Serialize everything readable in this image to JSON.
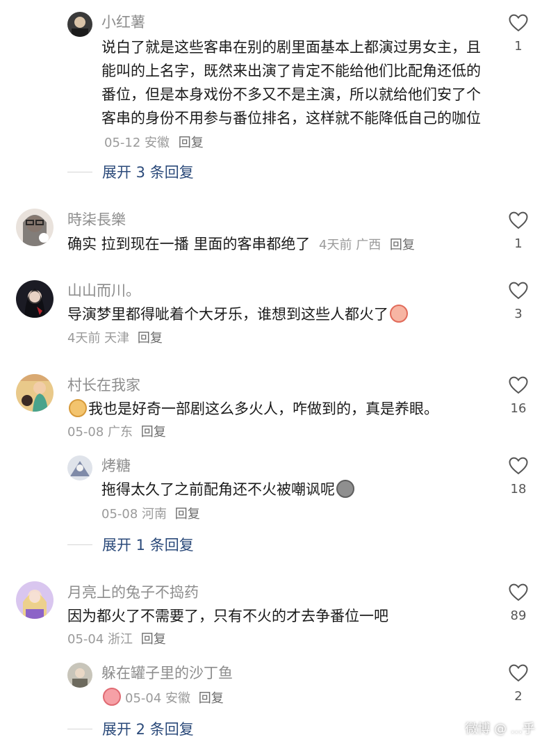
{
  "colors": {
    "name": "#8d8d8d",
    "text": "#1a1a1a",
    "meta": "#9a9a9a",
    "expand": "#2b4a7a",
    "like_icon": "#555555"
  },
  "comments": [
    {
      "name": "小红薯",
      "text": "说白了就是这些客串在别的剧里面基本上都演过男女主，且能叫的上名字，既然来出演了肯定不能给他们比配角还低的番位，但是本身戏份不多又不是主演，所以就给他们安了个客串的身份不用参与番位排名，这样就不能降低自己的咖位",
      "meta": "05-12 安徽",
      "reply": "回复",
      "likes": "1",
      "expand": "展开 3 条回复"
    },
    {
      "name": "時柒長樂",
      "text": "确实 拉到现在一播 里面的客串都绝了",
      "meta": "4天前 广西",
      "reply": "回复",
      "likes": "1"
    },
    {
      "name": "山山而川。",
      "text": "导演梦里都得呲着个大牙乐，谁想到这些人都火了",
      "emoji": "crying-face-emoji",
      "meta": "4天前 天津",
      "reply": "回复",
      "likes": "3"
    },
    {
      "name": "村长在我家",
      "emoji": "dog-face-emoji",
      "text": "我也是好奇一部剧这么多火人，咋做到的，真是养眼。",
      "meta": "05-08 广东",
      "reply": "回复",
      "likes": "16",
      "sub": {
        "name": "烤糖",
        "text": "拖得太久了之前配角还不火被嘲讽呢",
        "emoji": "money-bag-emoji",
        "meta": "05-08 河南",
        "reply": "回复",
        "likes": "18"
      },
      "expand": "展开 1 条回复"
    },
    {
      "name": "月亮上的兔子不捣药",
      "text": "因为都火了不需要了，只有不火的才去争番位一吧",
      "meta": "05-04 浙江",
      "reply": "回复",
      "likes": "89",
      "sub": {
        "name": "躲在罐子里的沙丁鱼",
        "emoji": "peach-face-emoji",
        "meta": "05-04 安徽",
        "reply": "回复",
        "likes": "2"
      },
      "expand": "展开 2 条回复"
    }
  ],
  "watermark": "微博 @ ...乎"
}
